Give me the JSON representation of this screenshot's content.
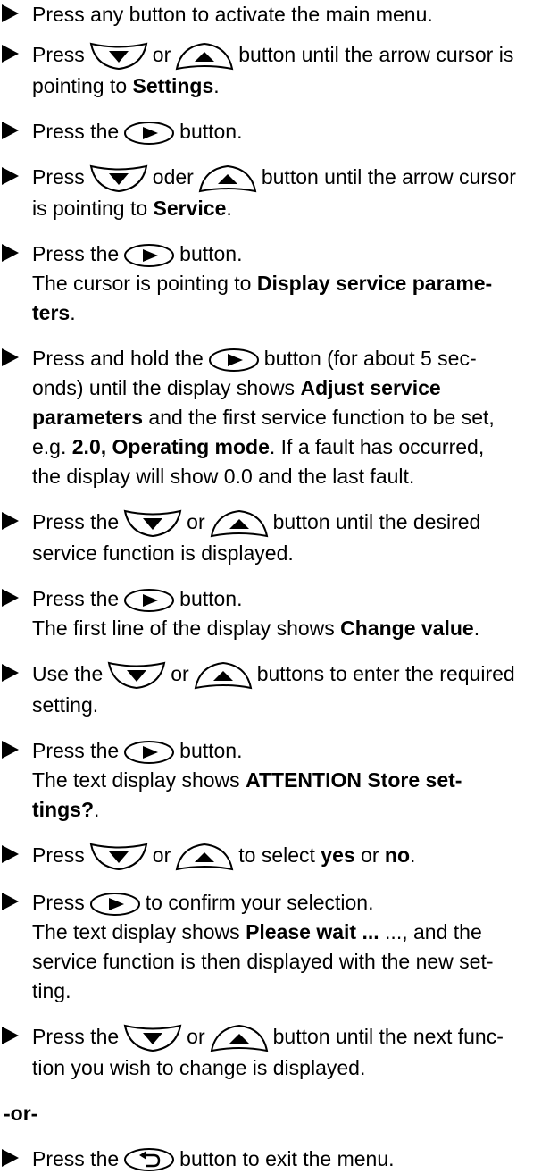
{
  "step1": {
    "a": "Press any button to activate the main menu."
  },
  "step2": {
    "a": "Press",
    "b": "or",
    "c": "button until the arrow cursor is",
    "d": "pointing to",
    "e": "Settings",
    "f": "."
  },
  "step3": {
    "a": "Press the",
    "b": "button."
  },
  "step4": {
    "a": "Press",
    "b": "oder",
    "c": "button until the arrow cursor",
    "d": "is pointing to",
    "e": "Service",
    "f": "."
  },
  "step5": {
    "a": "Press the",
    "b": "button.",
    "c": "The cursor is pointing to",
    "d": "Display service parame-",
    "e": "ters",
    "f": "."
  },
  "step6": {
    "a": "Press and hold the",
    "b": "button (for about 5 sec-",
    "c": "onds) until the display shows",
    "d": "Adjust service",
    "e": "parameters",
    "f": "and the first service function to be set,",
    "g": "e.g.",
    "h": "2.0, Operating mode",
    "i": ". If a fault has occurred,",
    "j": "the display will show 0.0 and the last fault."
  },
  "step7": {
    "a": "Press the",
    "b": "or",
    "c": "button until the desired",
    "d": "service function is displayed."
  },
  "step8": {
    "a": "Press the",
    "b": "button.",
    "c": "The first line of the display shows",
    "d": "Change value",
    "e": "."
  },
  "step9": {
    "a": "Use the",
    "b": "or",
    "c": "buttons to enter the required",
    "d": "setting."
  },
  "step10": {
    "a": "Press the",
    "b": "button.",
    "c": "The text display shows",
    "d": "ATTENTION Store set-",
    "e": "tings?",
    "f": "."
  },
  "step11": {
    "a": "Press",
    "b": "or",
    "c": "to select",
    "d": "yes",
    "e": "or",
    "f": "no",
    "g": "."
  },
  "step12": {
    "a": "Press",
    "b": "to confirm your selection.",
    "c": "The text display shows",
    "d": "Please wait ...",
    "e": "..., and the",
    "f": "service function is then displayed with the new set-",
    "g": "ting."
  },
  "step13": {
    "a": "Press the",
    "b": "or",
    "c": "button until the next func-",
    "d": "tion you wish to change is displayed."
  },
  "or_separator": "-or-",
  "step14": {
    "a": "Press the",
    "b": "button to exit the menu."
  },
  "icons": {
    "down": "down-arrow-button-icon",
    "up": "up-arrow-button-icon",
    "right": "right-arrow-button-icon",
    "back": "back-return-button-icon"
  }
}
